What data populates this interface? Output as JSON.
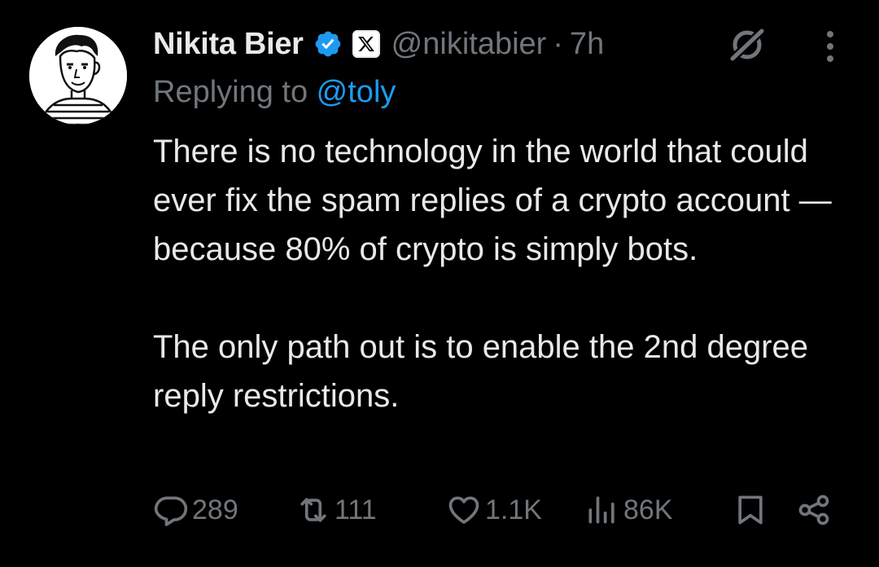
{
  "author": {
    "name": "Nikita Bier",
    "handle": "@nikitabier",
    "separator": "·",
    "time": "7h",
    "verified_color": "#1d9bf0"
  },
  "reply": {
    "prefix": "Replying to ",
    "mention": "@toly"
  },
  "tweet": {
    "paragraphs": [
      "There is no technology in the world that could ever fix the spam replies of a crypto account — because 80% of crypto is simply bots.",
      "The only path out is to enable the 2nd degree reply restrictions."
    ]
  },
  "actions": {
    "replies": "289",
    "reposts": "111",
    "likes": "1.1K",
    "views": "86K"
  },
  "icons": {
    "verified": "verified-badge-icon",
    "affiliate": "x-logo-icon",
    "grok": "grok-icon",
    "more": "more-dots-icon",
    "reply": "reply-bubble-icon",
    "repost": "repost-icon",
    "like": "heart-icon",
    "views": "views-bars-icon",
    "bookmark": "bookmark-icon",
    "share": "share-icon"
  },
  "colors": {
    "background": "#000000",
    "text": "#e7e9ea",
    "muted": "#71767b",
    "accent": "#1d9bf0"
  }
}
